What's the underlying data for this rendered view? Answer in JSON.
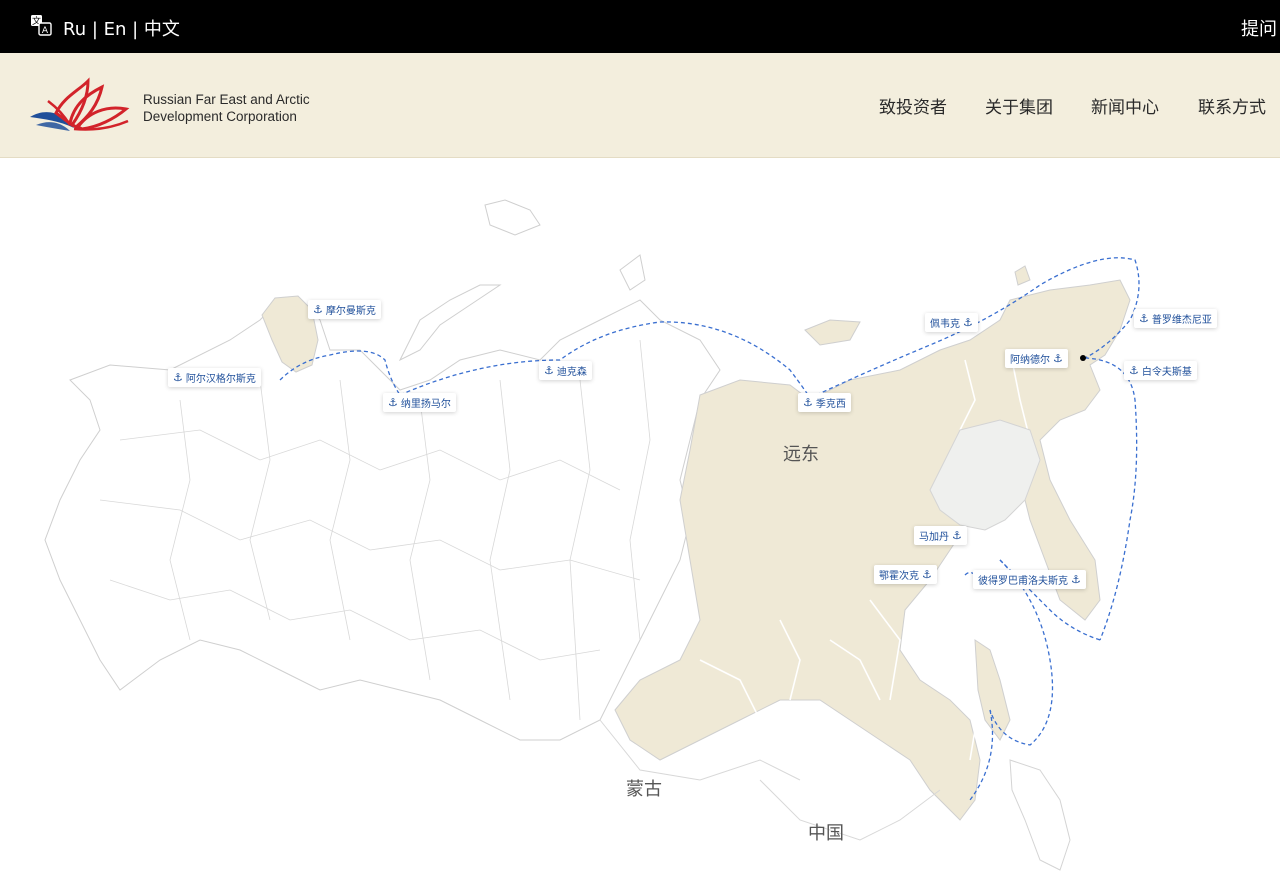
{
  "topbar": {
    "lang_ru": "Ru",
    "lang_sep1": " | ",
    "lang_en": "En",
    "lang_sep2": " | ",
    "lang_zh": "中文",
    "ask": "提问"
  },
  "header": {
    "logo_line1": "Russian Far East and Arctic",
    "logo_line2": "Development Corporation",
    "nav": [
      "致投资者",
      "关于集团",
      "新闻中心",
      "联系方式"
    ]
  },
  "map": {
    "regions": {
      "far_east": "远东",
      "mongolia": "蒙古",
      "china": "中国"
    },
    "ports": {
      "murmansk": "摩尔曼斯克",
      "arkhangelsk": "阿尔汉格尔斯克",
      "naryan_mar": "纳里扬马尔",
      "dikson": "迪克森",
      "tiksi": "季克西",
      "pevek": "佩韦克",
      "provideniya": "普罗维杰尼亚",
      "anadyr": "阿纳德尔",
      "beringovsky": "白令夫斯基",
      "magadan": "马加丹",
      "okhotsk": "鄂霍次克",
      "petropavlovsk": "彼得罗巴甫洛夫斯克"
    },
    "colors": {
      "far_east_fill": "#efe9d6",
      "route": "#3a6fd0",
      "port_text": "#1f4f9a"
    }
  }
}
